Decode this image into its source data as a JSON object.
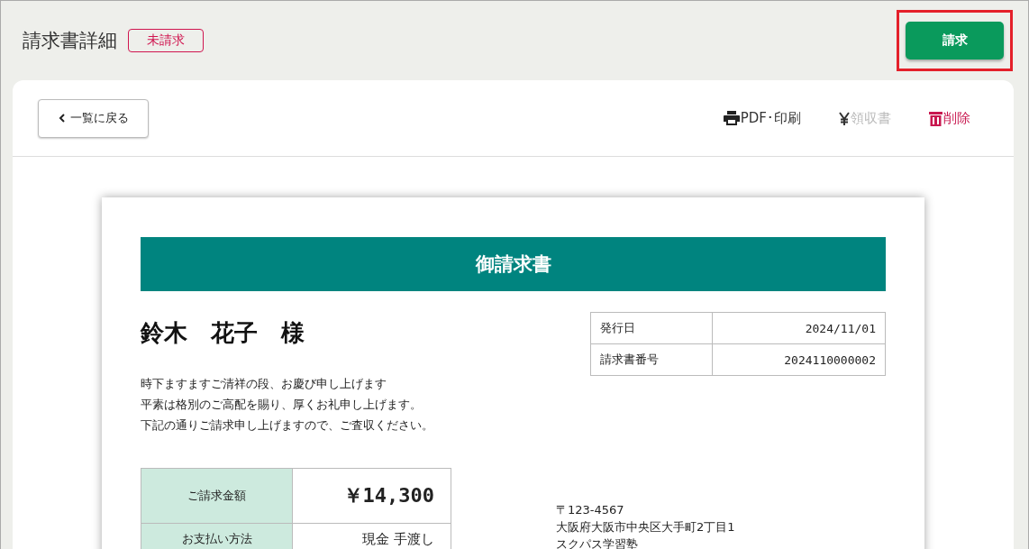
{
  "header": {
    "title": "請求書詳細",
    "status_badge": "未請求",
    "primary_button": "請求",
    "highlighted": true
  },
  "toolbar": {
    "back_button": "一覧に戻る",
    "actions": [
      {
        "kind": "print",
        "label": "PDF･印刷",
        "disabled": false
      },
      {
        "kind": "receipt",
        "label": "領収書",
        "disabled": true
      },
      {
        "kind": "delete",
        "label": "削除",
        "disabled": false
      }
    ]
  },
  "invoice": {
    "banner": "御請求書",
    "recipient": "鈴木　花子　様",
    "greeting": [
      "時下ますますご清祥の段、お慶び申し上げます",
      "平素は格別のご高配を賜り、厚くお礼申し上げます。",
      "下記の通りご請求申し上げますので、ご査収ください。"
    ],
    "info": [
      {
        "label": "発行日",
        "value": "2024/11/01"
      },
      {
        "label": "請求書番号",
        "value": "2024110000002"
      }
    ],
    "summary": [
      {
        "label": "ご請求金額",
        "value": "￥14,300",
        "kind": "amount"
      },
      {
        "label": "お支払い方法",
        "value": "現金 手渡し",
        "kind": "plain"
      }
    ],
    "issuer": [
      "〒123-4567",
      "大阪府大阪市中央区大手町2丁目1",
      "スクパス学習塾"
    ]
  }
}
